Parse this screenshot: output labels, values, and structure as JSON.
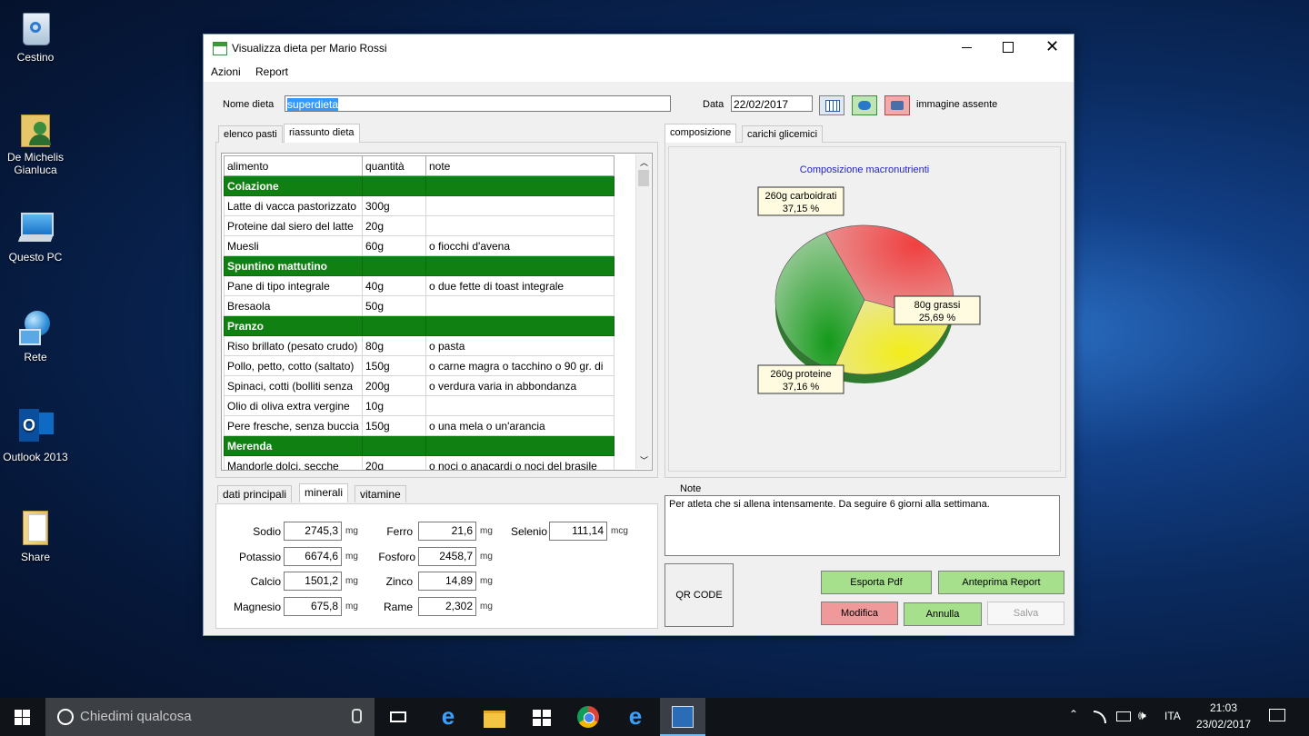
{
  "desktop": {
    "icons": [
      {
        "label": "Cestino",
        "icon": "recycle-bin-icon"
      },
      {
        "label": "De Michelis Gianluca",
        "icon": "user-folder-icon"
      },
      {
        "label": "Questo PC",
        "icon": "computer-icon"
      },
      {
        "label": "Rete",
        "icon": "network-icon"
      },
      {
        "label": "Outlook 2013",
        "icon": "outlook-icon"
      },
      {
        "label": "Share",
        "icon": "folder-icon"
      }
    ]
  },
  "window": {
    "title": "Visualizza dieta per Mario Rossi",
    "menu": [
      "Azioni",
      "Report"
    ],
    "nome_dieta_label": "Nome dieta",
    "nome_dieta_value": "superdieta",
    "data_label": "Data",
    "data_value": "22/02/2017",
    "image_status": "immagine assente",
    "left_tabs": [
      "elenco pasti",
      "riassunto dieta"
    ],
    "right_tabs": [
      "composizione",
      "carichi glicemici"
    ],
    "grid": {
      "headers": [
        "alimento",
        "quantità",
        "note"
      ],
      "rows": [
        {
          "group": true,
          "alimento": "Colazione",
          "quantita": "",
          "note": ""
        },
        {
          "group": false,
          "alimento": "Latte di vacca pastorizzato",
          "quantita": "300g",
          "note": ""
        },
        {
          "group": false,
          "alimento": "Proteine dal siero del latte",
          "quantita": "20g",
          "note": ""
        },
        {
          "group": false,
          "alimento": "Muesli",
          "quantita": "60g",
          "note": "o fiocchi d'avena"
        },
        {
          "group": true,
          "alimento": "Spuntino mattutino",
          "quantita": "",
          "note": ""
        },
        {
          "group": false,
          "alimento": "Pane di tipo integrale",
          "quantita": "40g",
          "note": "o due fette di toast integrale"
        },
        {
          "group": false,
          "alimento": "Bresaola",
          "quantita": "50g",
          "note": ""
        },
        {
          "group": true,
          "alimento": "Pranzo",
          "quantita": "",
          "note": ""
        },
        {
          "group": false,
          "alimento": "Riso brillato (pesato crudo)",
          "quantita": "80g",
          "note": "o pasta"
        },
        {
          "group": false,
          "alimento": "Pollo, petto, cotto (saltato)",
          "quantita": "150g",
          "note": "o carne magra o tacchino o 90 gr. di"
        },
        {
          "group": false,
          "alimento": "Spinaci, cotti (bolliti senza",
          "quantita": "200g",
          "note": "o verdura varia in abbondanza"
        },
        {
          "group": false,
          "alimento": "Olio di oliva extra vergine",
          "quantita": "10g",
          "note": ""
        },
        {
          "group": false,
          "alimento": "Pere fresche, senza buccia",
          "quantita": "150g",
          "note": "o una mela o un'arancia"
        },
        {
          "group": true,
          "alimento": "Merenda",
          "quantita": "",
          "note": ""
        },
        {
          "group": false,
          "alimento": "Mandorle dolci, secche",
          "quantita": "20g",
          "note": "o noci o anacardi o noci del brasile"
        }
      ]
    },
    "chart_data": {
      "type": "pie",
      "title": "Composizione macronutrienti",
      "slices": [
        {
          "label": "260g carboidrati",
          "percent_label": "37,15 %",
          "value": 37.15,
          "color": "#e0262b"
        },
        {
          "label": "80g grassi",
          "percent_label": "25,69 %",
          "value": 25.69,
          "color": "#e6e01e"
        },
        {
          "label": "260g proteine",
          "percent_label": "37,16 %",
          "value": 37.16,
          "color": "#1f9a26"
        }
      ]
    },
    "bottom_tabs": [
      "dati principali",
      "minerali",
      "vitamine"
    ],
    "minerals": [
      {
        "name": "Sodio",
        "value": "2745,3",
        "unit": "mg"
      },
      {
        "name": "Potassio",
        "value": "6674,6",
        "unit": "mg"
      },
      {
        "name": "Calcio",
        "value": "1501,2",
        "unit": "mg"
      },
      {
        "name": "Magnesio",
        "value": "675,8",
        "unit": "mg"
      },
      {
        "name": "Ferro",
        "value": "21,6",
        "unit": "mg"
      },
      {
        "name": "Fosforo",
        "value": "2458,7",
        "unit": "mg"
      },
      {
        "name": "Zinco",
        "value": "14,89",
        "unit": "mg"
      },
      {
        "name": "Rame",
        "value": "2,302",
        "unit": "mg"
      },
      {
        "name": "Selenio",
        "value": "111,14",
        "unit": "mcg"
      }
    ],
    "note_label": "Note",
    "note_text": "Per atleta che si allena intensamente. Da seguire 6 giorni alla settimana.",
    "qr_label": "QR CODE",
    "buttons": {
      "esporta": "Esporta Pdf",
      "anteprima": "Anteprima Report",
      "modifica": "Modifica",
      "annulla": "Annulla",
      "salva": "Salva"
    },
    "colors": {
      "green_button": "#a6e08c",
      "red_button": "#f0999a",
      "group_row": "#118012"
    }
  },
  "taskbar": {
    "search_placeholder": "Chiedimi qualcosa",
    "language": "ITA",
    "time": "21:03",
    "date": "23/02/2017"
  }
}
